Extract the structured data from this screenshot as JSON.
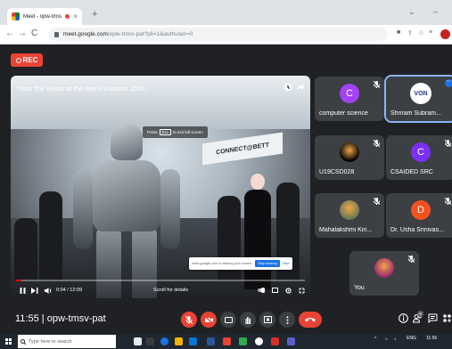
{
  "browser": {
    "tab_title": "Meet - opw-tmsv-pat",
    "tab_close": "×",
    "new_tab": "+",
    "win_min": "⌄",
    "win_min2": "–",
    "url_host": "meet.google.com",
    "url_path": "/opw-tmsv-pat?pli=1&authuser=0"
  },
  "meet": {
    "rec_label": "REC",
    "video_title": "Titan The Robot at the Bett Exhibition 2020.",
    "booth_sign": "CONNECT@BETT",
    "esc_press": "Press",
    "esc_key": "Esc",
    "esc_rest": "to exit full screen",
    "share_text": "meet.google.com is sharing your screen.",
    "share_stop": "Stop sharing",
    "share_hide": "Hide",
    "progress": 0.02,
    "video_time": "0:04 / 12:09",
    "scroll_hint": "Scroll for details",
    "meeting_time": "11:55",
    "meeting_sep": "|",
    "meeting_code": "opw-tmsv-pat",
    "people_badge": "8"
  },
  "participants": [
    {
      "name": "computer science",
      "initial": "C",
      "color": "#a142f4",
      "kind": "avatar"
    },
    {
      "name": "Shriram Subram...",
      "initial": "VON",
      "color": "#ffffff",
      "kind": "logo",
      "active": true
    },
    {
      "name": "U19CSD028",
      "initial": "",
      "color": "#000000",
      "kind": "photo"
    },
    {
      "name": "CSAIDED SRC",
      "initial": "C",
      "color": "#7b2ff7",
      "kind": "avatar"
    },
    {
      "name": "Mahalakshmi Kiri...",
      "initial": "",
      "color": "#6b7a55",
      "kind": "photo"
    },
    {
      "name": "Dr. Usha Srinivas...",
      "initial": "D",
      "color": "#f4511e",
      "kind": "avatar"
    },
    {
      "name": "You",
      "initial": "",
      "color": "#9b2c6a",
      "kind": "photo"
    }
  ],
  "taskbar": {
    "search_placeholder": "Type here to search",
    "lang": "ENG",
    "time": "11:56"
  }
}
